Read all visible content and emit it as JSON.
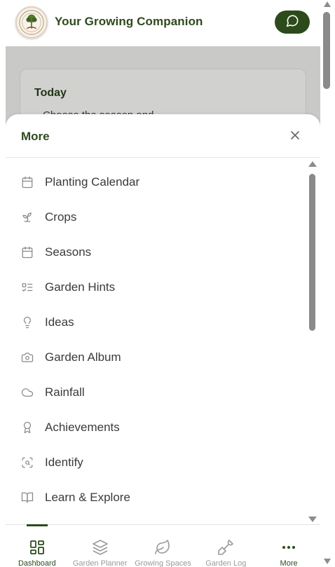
{
  "header": {
    "title": "Your Growing Companion",
    "logo_icon": "garden-logo",
    "chat_icon": "chat-bubble-icon"
  },
  "dashboard": {
    "today_title": "Today",
    "today_line": "Choose the season and"
  },
  "sheet": {
    "title": "More",
    "close_icon": "close-icon",
    "items": [
      {
        "label": "Planting Calendar",
        "icon": "calendar-icon"
      },
      {
        "label": "Crops",
        "icon": "sprout-icon"
      },
      {
        "label": "Seasons",
        "icon": "calendar-icon"
      },
      {
        "label": "Garden Hints",
        "icon": "checklist-icon"
      },
      {
        "label": "Ideas",
        "icon": "lightbulb-icon"
      },
      {
        "label": "Garden Album",
        "icon": "camera-icon"
      },
      {
        "label": "Rainfall",
        "icon": "cloud-icon"
      },
      {
        "label": "Achievements",
        "icon": "award-icon"
      },
      {
        "label": "Identify",
        "icon": "scan-icon"
      },
      {
        "label": "Learn & Explore",
        "icon": "book-open-icon"
      }
    ]
  },
  "bottom_nav": {
    "items": [
      {
        "label": "Dashboard",
        "icon": "dashboard-grid-icon",
        "active": true
      },
      {
        "label": "Garden Planner",
        "icon": "layers-icon",
        "active": false
      },
      {
        "label": "Growing Spaces",
        "icon": "leaf-icon",
        "active": false
      },
      {
        "label": "Garden Log",
        "icon": "shovel-icon",
        "active": false
      },
      {
        "label": "More",
        "icon": "more-dots-icon",
        "active": false
      }
    ]
  },
  "colors": {
    "brand_green": "#2d4a1b",
    "title_green": "#2f4a1f",
    "overlay_gray": "#c9c9c7",
    "icon_gray": "#8a8a8a"
  }
}
